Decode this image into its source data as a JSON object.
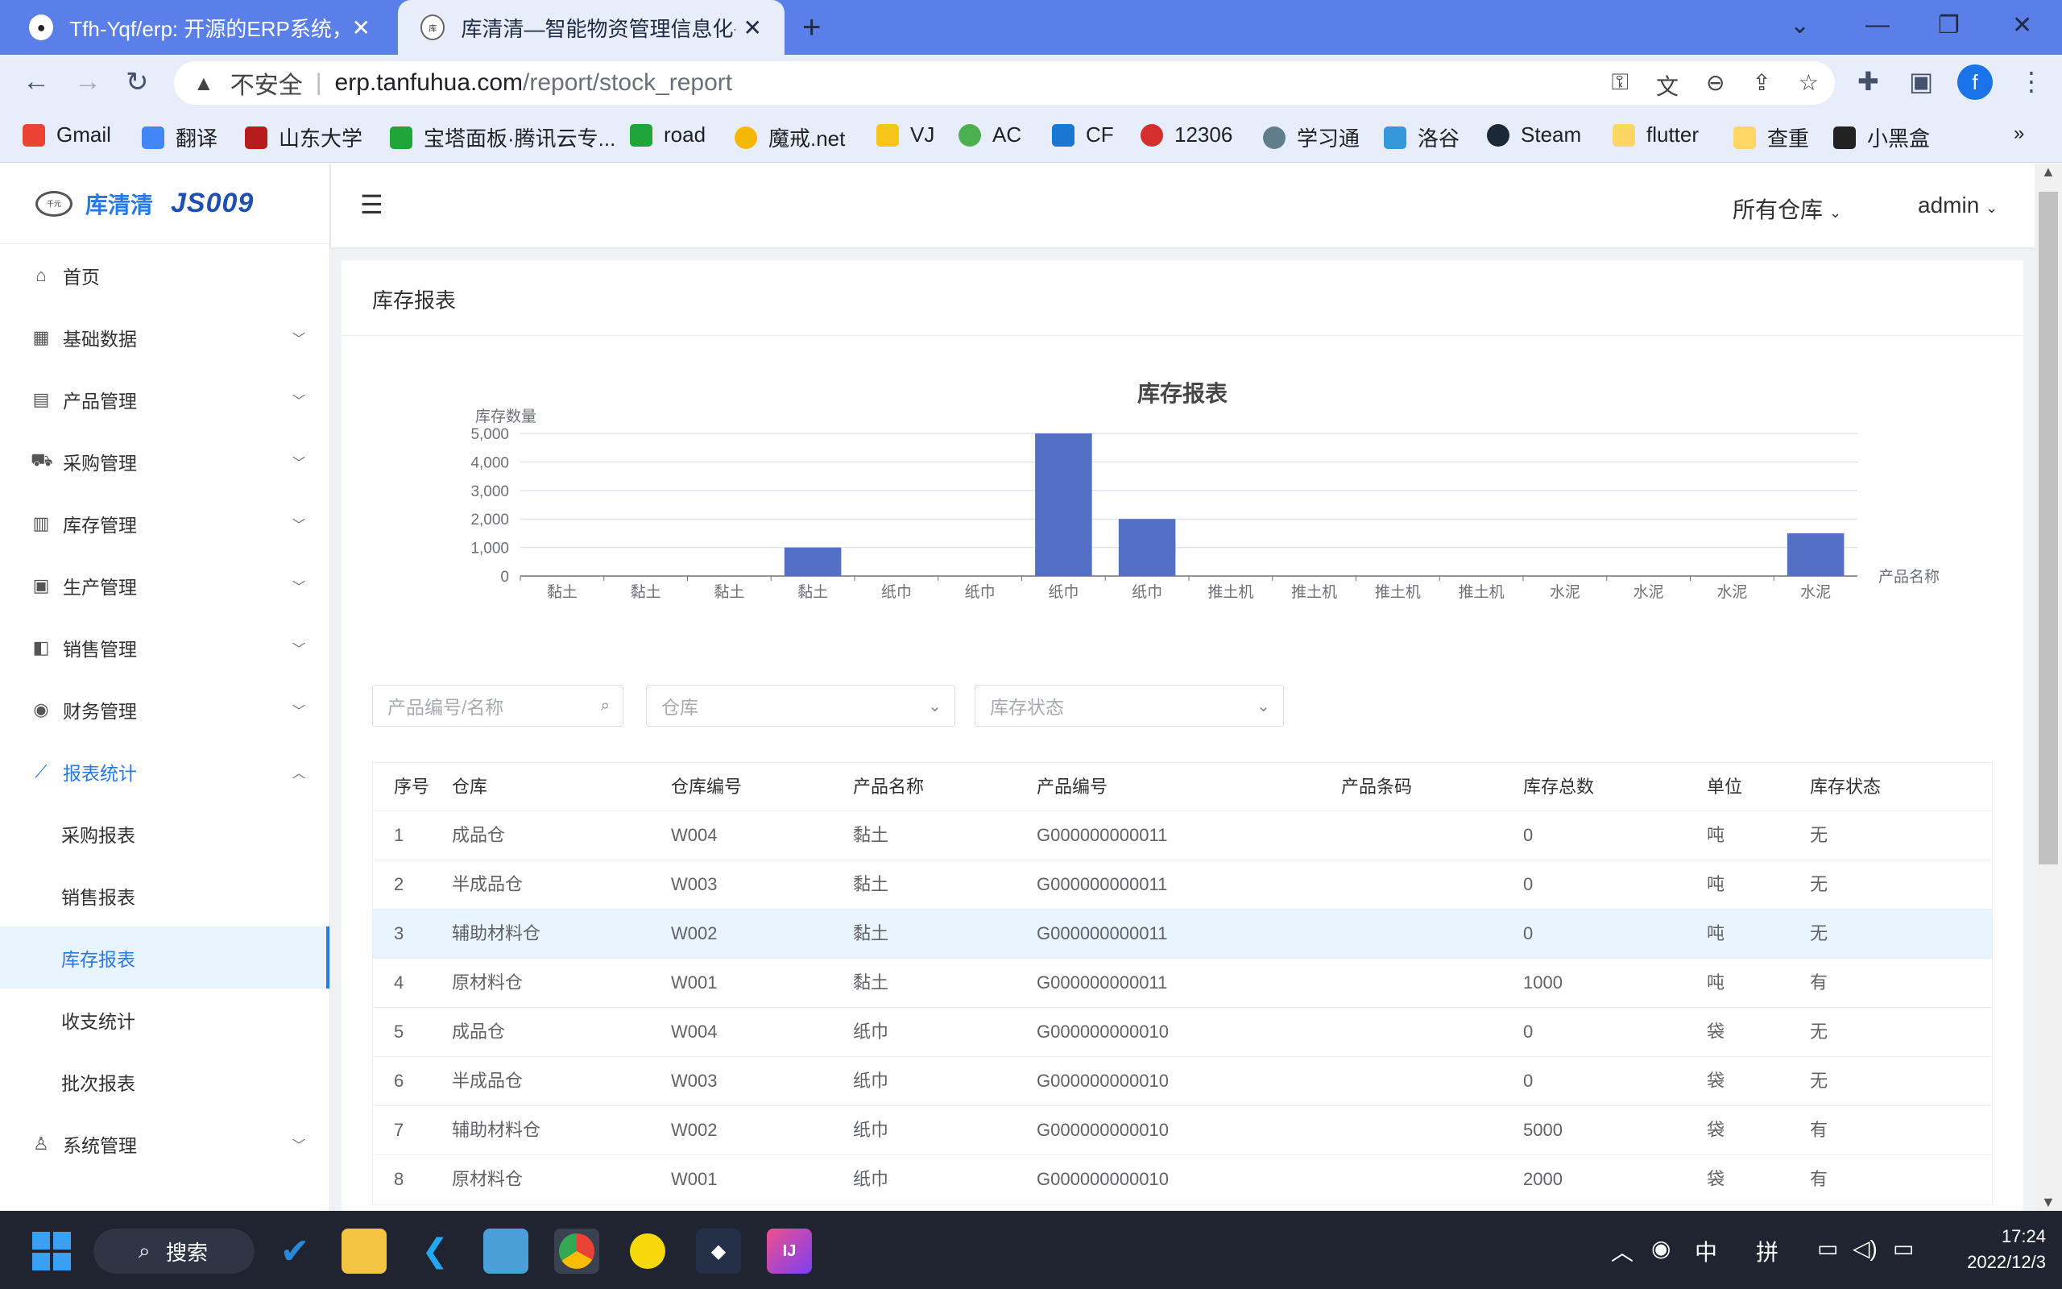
{
  "browser": {
    "tabs": [
      {
        "title": "Tfh-Yqf/erp: 开源的ERP系统，使",
        "icon": "github-icon"
      },
      {
        "title": "库清清—智能物资管理信息化平台",
        "icon": "site-icon"
      }
    ],
    "address": {
      "security_label": "不安全",
      "host": "erp.tanfuhua.com",
      "path": "/report/stock_report"
    },
    "profile_initial": "f",
    "bookmarks": [
      {
        "label": "Gmail",
        "color": "#ea4335"
      },
      {
        "label": "翻译",
        "color": "#4285f4"
      },
      {
        "label": "山东大学",
        "color": "#b71c1c"
      },
      {
        "label": "宝塔面板·腾讯云专...",
        "color": "#20a53a"
      },
      {
        "label": "road",
        "color": "#20a53a"
      },
      {
        "label": "魔戒.net",
        "color": "#f5b800"
      },
      {
        "label": "VJ",
        "color": "#f5c518"
      },
      {
        "label": "AC",
        "color": "#4caf50"
      },
      {
        "label": "CF",
        "color": "#1976d2"
      },
      {
        "label": "12306",
        "color": "#d32f2f"
      },
      {
        "label": "学习通",
        "color": "#607d8b"
      },
      {
        "label": "洛谷",
        "color": "#3498db"
      },
      {
        "label": "Steam",
        "color": "#1b2838"
      },
      {
        "label": "flutter",
        "color": "#fdd663"
      },
      {
        "label": "查重",
        "color": "#fdd663"
      },
      {
        "label": "小黑盒",
        "color": "#222222"
      }
    ]
  },
  "app": {
    "brand_name": "库清清",
    "brand_badge": "JS009",
    "header": {
      "warehouse_select": "所有仓库",
      "user": "admin"
    },
    "menu": [
      {
        "label": "首页",
        "icon": "home-icon",
        "has_arrow": false
      },
      {
        "label": "基础数据",
        "icon": "grid-icon",
        "has_arrow": true
      },
      {
        "label": "产品管理",
        "icon": "apps-icon",
        "has_arrow": true
      },
      {
        "label": "采购管理",
        "icon": "cart-icon",
        "has_arrow": true
      },
      {
        "label": "库存管理",
        "icon": "document-icon",
        "has_arrow": true
      },
      {
        "label": "生产管理",
        "icon": "calendar-icon",
        "has_arrow": true
      },
      {
        "label": "销售管理",
        "icon": "bag-icon",
        "has_arrow": true
      },
      {
        "label": "财务管理",
        "icon": "coin-icon",
        "has_arrow": true
      },
      {
        "label": "报表统计",
        "icon": "chart-icon",
        "has_arrow": true,
        "open": true
      },
      {
        "label": "采购报表",
        "sub": true
      },
      {
        "label": "销售报表",
        "sub": true
      },
      {
        "label": "库存报表",
        "sub": true,
        "active": true
      },
      {
        "label": "收支统计",
        "sub": true
      },
      {
        "label": "批次报表",
        "sub": true
      },
      {
        "label": "系统管理",
        "icon": "user-icon",
        "has_arrow": true
      }
    ],
    "page_title": "库存报表",
    "filters": {
      "product_placeholder": "产品编号/名称",
      "warehouse_placeholder": "仓库",
      "status_placeholder": "库存状态"
    },
    "table": {
      "columns": [
        "序号",
        "仓库",
        "仓库编号",
        "产品名称",
        "产品编号",
        "产品条码",
        "库存总数",
        "单位",
        "库存状态"
      ],
      "rows": [
        [
          "1",
          "成品仓",
          "W004",
          "黏土",
          "G000000000011",
          "",
          "0",
          "吨",
          "无"
        ],
        [
          "2",
          "半成品仓",
          "W003",
          "黏土",
          "G000000000011",
          "",
          "0",
          "吨",
          "无"
        ],
        [
          "3",
          "辅助材料仓",
          "W002",
          "黏土",
          "G000000000011",
          "",
          "0",
          "吨",
          "无"
        ],
        [
          "4",
          "原材料仓",
          "W001",
          "黏土",
          "G000000000011",
          "",
          "1000",
          "吨",
          "有"
        ],
        [
          "5",
          "成品仓",
          "W004",
          "纸巾",
          "G000000000010",
          "",
          "0",
          "袋",
          "无"
        ],
        [
          "6",
          "半成品仓",
          "W003",
          "纸巾",
          "G000000000010",
          "",
          "0",
          "袋",
          "无"
        ],
        [
          "7",
          "辅助材料仓",
          "W002",
          "纸巾",
          "G000000000010",
          "",
          "5000",
          "袋",
          "有"
        ],
        [
          "8",
          "原材料仓",
          "W001",
          "纸巾",
          "G000000000010",
          "",
          "2000",
          "袋",
          "有"
        ]
      ],
      "highlighted_row": 2
    }
  },
  "chart_data": {
    "type": "bar",
    "title": "库存报表",
    "ylabel": "库存数量",
    "xlabel": "产品名称",
    "ylim": [
      0,
      5000
    ],
    "yticks": [
      "0",
      "1,000",
      "2,000",
      "3,000",
      "4,000",
      "5,000"
    ],
    "categories": [
      "黏土",
      "黏土",
      "黏土",
      "黏土",
      "纸巾",
      "纸巾",
      "纸巾",
      "纸巾",
      "推土机",
      "推土机",
      "推土机",
      "推土机",
      "水泥",
      "水泥",
      "水泥",
      "水泥"
    ],
    "values": [
      0,
      0,
      0,
      1000,
      0,
      0,
      5000,
      2000,
      0,
      0,
      0,
      0,
      0,
      0,
      0,
      1500
    ],
    "color": "#5470c6",
    "grid": true
  },
  "taskbar": {
    "search_label": "搜索",
    "ime_lang": "中",
    "ime_mode": "拼",
    "time": "17:24",
    "date": "2022/12/3"
  }
}
